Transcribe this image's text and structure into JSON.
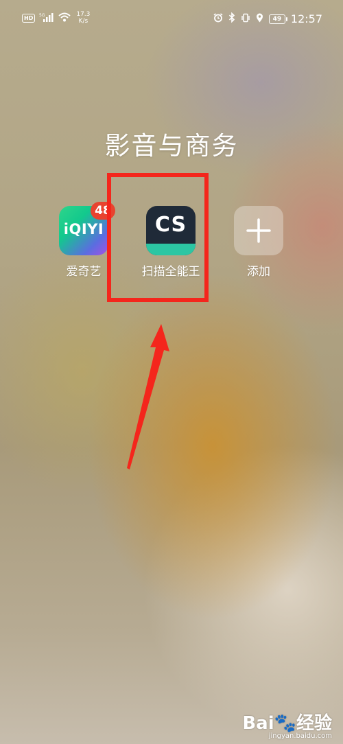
{
  "status_bar": {
    "hd_badge": "HD",
    "signal_label": "5G",
    "net_speed_value": "17.3",
    "net_speed_unit": "K/s",
    "battery_level": "49",
    "time": "12:57"
  },
  "folder": {
    "title": "影音与商务",
    "apps": [
      {
        "label": "爱奇艺",
        "icon_text": "iQIYI",
        "badge": "48"
      },
      {
        "label": "扫描全能王",
        "icon_text": "CS"
      },
      {
        "label": "添加"
      }
    ]
  },
  "annotation": {
    "highlight_color": "#f4261c",
    "arrow_color": "#f4261c"
  },
  "watermark": {
    "logo": "Bai🐾经验",
    "url": "jingyan.baidu.com"
  }
}
